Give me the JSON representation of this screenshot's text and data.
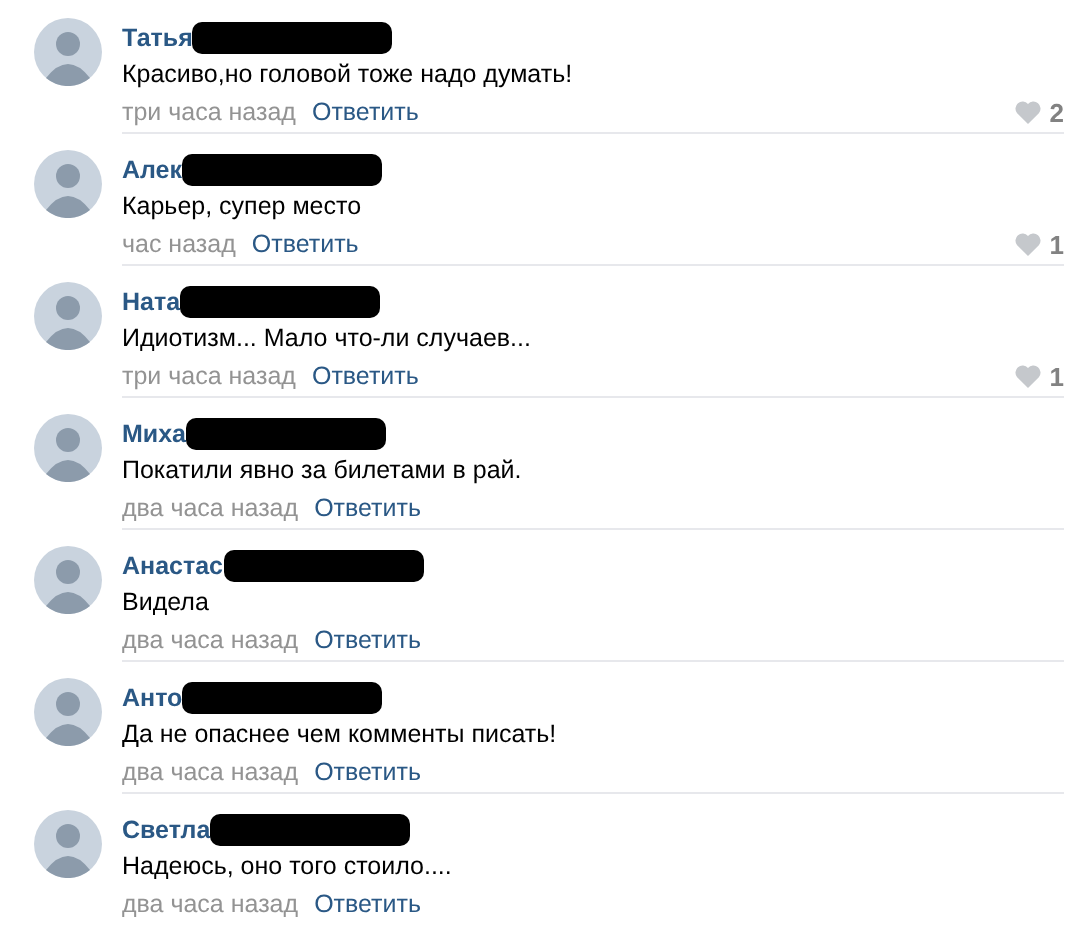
{
  "comments": [
    {
      "author": "Татья",
      "redacted": true,
      "text": "Красиво,но головой тоже надо думать!",
      "time": "три часа назад",
      "reply": "Ответить",
      "likes": "2"
    },
    {
      "author": "Алек",
      "redacted": true,
      "text": "Карьер, супер место",
      "time": "час назад",
      "reply": "Ответить",
      "likes": "1"
    },
    {
      "author": "Ната",
      "redacted": true,
      "text": "Идиотизм... Мало что-ли случаев...",
      "time": "три часа назад",
      "reply": "Ответить",
      "likes": "1"
    },
    {
      "author": "Миха",
      "redacted": true,
      "text": "Покатили явно за билетами в рай.",
      "time": "два часа назад",
      "reply": "Ответить"
    },
    {
      "author": "Анастас",
      "redacted": true,
      "text": "Видела",
      "time": "два часа назад",
      "reply": "Ответить"
    },
    {
      "author": "Анто",
      "redacted": true,
      "text": "Да не опаснее чем комменты писать!",
      "time": "два часа назад",
      "reply": "Ответить"
    },
    {
      "author": "Светла",
      "redacted": true,
      "text": "Надеюсь, оно того стоило....",
      "time": "два часа назад",
      "reply": "Ответить"
    }
  ]
}
